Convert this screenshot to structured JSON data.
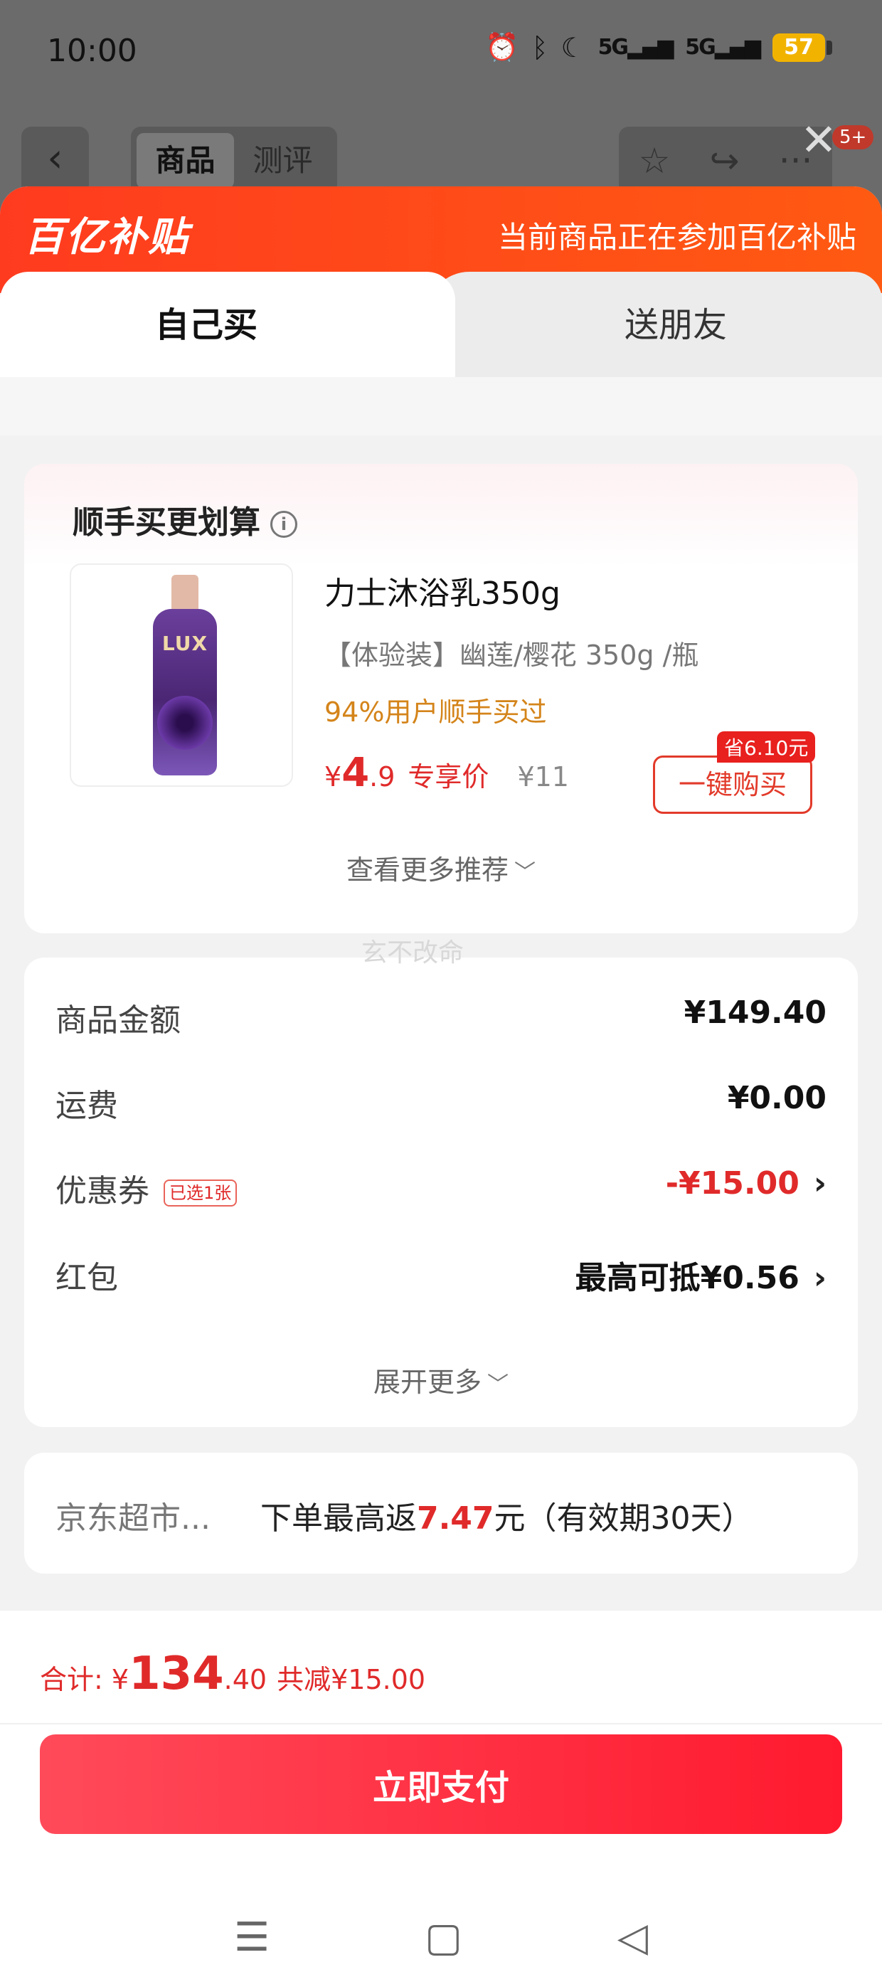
{
  "status_bar": {
    "time": "10:00",
    "signal1": "5G",
    "signal2": "5G",
    "battery": "57"
  },
  "product_header": {
    "tabs": [
      "商品",
      "测评"
    ],
    "badge": "5+"
  },
  "banner": {
    "brand": "百亿补贴",
    "note": "当前商品正在参加百亿补贴"
  },
  "purchase_tabs": {
    "self": "自己买",
    "gift": "送朋友"
  },
  "addon": {
    "title": "顺手买更划算",
    "product": {
      "name": "力士沐浴乳350g",
      "spec": "【体验装】幽莲/樱花  350g /瓶",
      "rate": "94%用户顺手买过",
      "currency": "¥",
      "price_int": "4",
      "price_dec": ".9",
      "price_tag": "专享价",
      "original_price": "¥11",
      "save_tag": "省6.10元",
      "buy_label": "一键购买",
      "image_brand": "LUX"
    },
    "more_label": "查看更多推荐"
  },
  "watermark": "玄不改命",
  "summary": {
    "rows": [
      {
        "label": "商品金额",
        "value": "¥149.40"
      },
      {
        "label": "运费",
        "value": "¥0.00"
      },
      {
        "label": "优惠券",
        "pill": "已选1张",
        "value": "-¥15.00"
      },
      {
        "label": "红包",
        "value": "最高可抵¥0.56"
      }
    ],
    "expand_label": "展开更多"
  },
  "rebate": {
    "store": "京东超市...",
    "text_before": "下单最高返",
    "amount": "7.47",
    "text_after": "元（有效期30天）"
  },
  "checkout": {
    "total_label": "合计: ",
    "currency": "¥",
    "total_int": "134",
    "total_dec": ".40",
    "discount": "共减¥15.00",
    "pay_label": "立即支付"
  },
  "colors": {
    "accent": "#e02a2a",
    "banner": "#ff4a18",
    "pay_button": "#ff1f35",
    "rate_text": "#d4841a"
  }
}
